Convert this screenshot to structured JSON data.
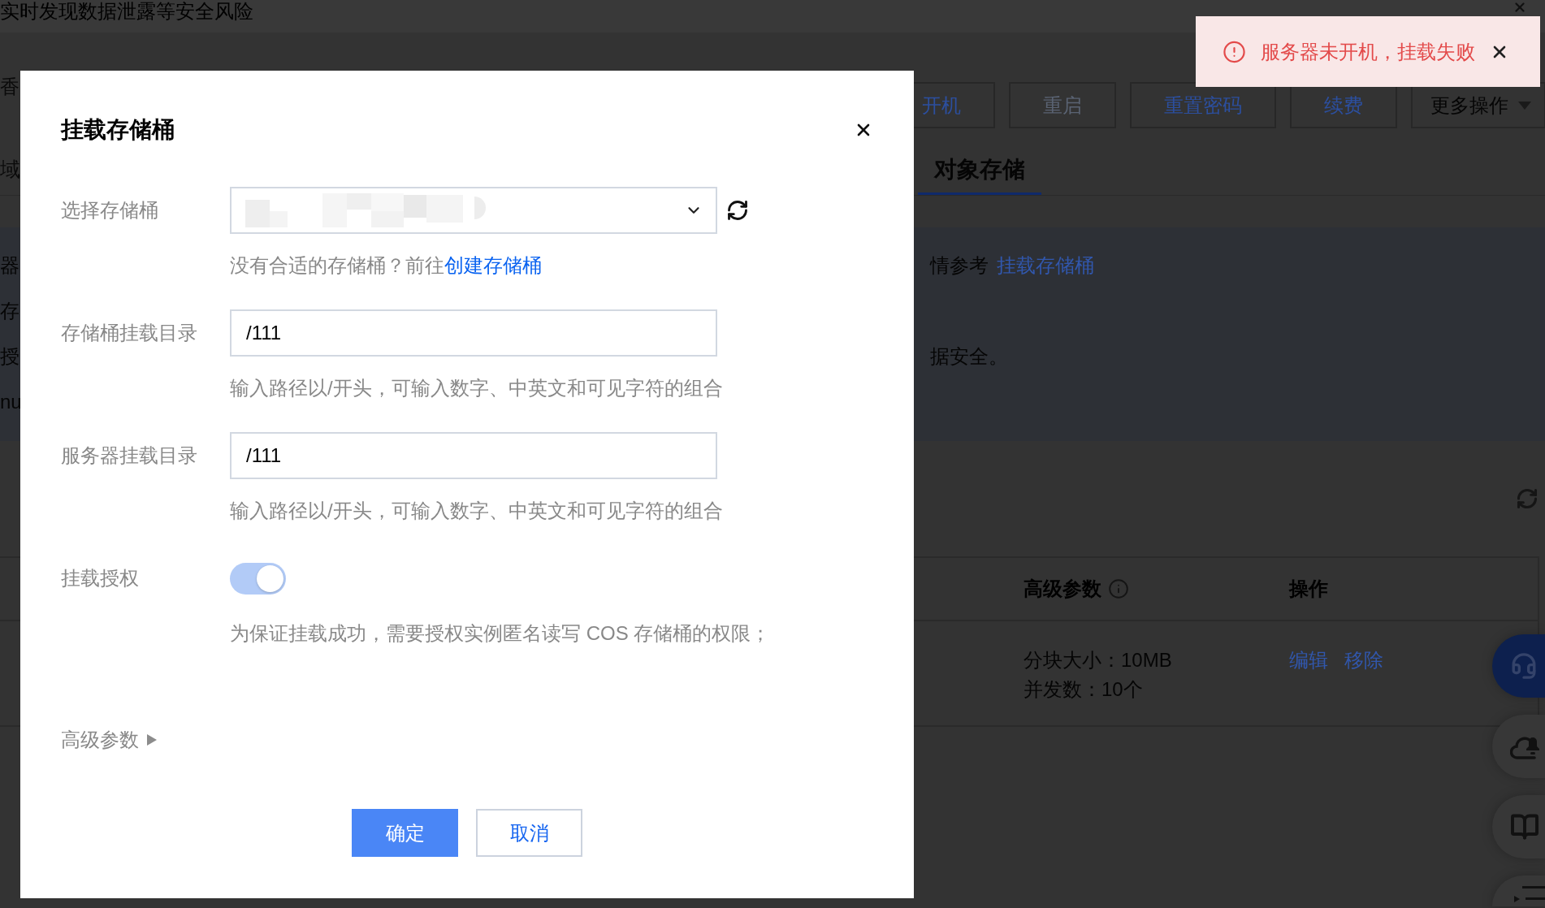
{
  "page": {
    "notice": "实时发现数据泄露等安全风险",
    "header_fragment": "香",
    "actions": [
      {
        "label": "开机",
        "kind": "plain",
        "disabled": false
      },
      {
        "label": "重启",
        "kind": "plain",
        "disabled": true
      },
      {
        "label": "重置密码",
        "kind": "plain",
        "disabled": false
      },
      {
        "label": "续费",
        "kind": "plain",
        "disabled": false
      },
      {
        "label": "更多操作",
        "kind": "dropdown",
        "disabled": false
      }
    ],
    "tabs": [
      {
        "label": "域",
        "selected": false
      },
      {
        "label": "对象存储",
        "selected": true
      }
    ],
    "info_lines": [
      {
        "fragment": "器",
        "text": "情参考",
        "link": "挂载存储桶"
      },
      {
        "fragment": "存"
      },
      {
        "fragment": "授",
        "text": "据安全。"
      },
      {
        "fragment": "nu"
      }
    ],
    "table": {
      "columns": [
        {
          "label": "高级参数",
          "info": true
        },
        {
          "label": "操作"
        }
      ],
      "rows": [
        {
          "params": [
            "分块大小：10MB",
            "并发数：10个"
          ],
          "actions": [
            "编辑",
            "移除"
          ]
        }
      ]
    }
  },
  "dialog": {
    "title": "挂载存储桶",
    "fields": [
      {
        "kind": "select",
        "label": "选择存储桶",
        "value_redacted": true,
        "hint": "没有合适的存储桶？前往",
        "hint_link": "创建存储桶"
      },
      {
        "kind": "input",
        "label": "存储桶挂载目录",
        "value": "/111",
        "hint": "输入路径以/开头，可输入数字、中英文和可见字符的组合"
      },
      {
        "kind": "input",
        "label": "服务器挂载目录",
        "value": "/111",
        "hint": "输入路径以/开头，可输入数字、中英文和可见字符的组合"
      },
      {
        "kind": "switch",
        "label": "挂载授权",
        "on": true,
        "disabled": true,
        "hint": "为保证挂载成功，需要授权实例匿名读写 COS 存储桶的权限；"
      }
    ],
    "advanced": {
      "label": "高级参数",
      "expanded": false
    },
    "buttons": [
      {
        "label": "确定",
        "kind": "primary"
      },
      {
        "label": "取消",
        "kind": "secondary"
      }
    ]
  },
  "toast": {
    "kind": "error",
    "message": "服务器未开机，挂载失败"
  }
}
